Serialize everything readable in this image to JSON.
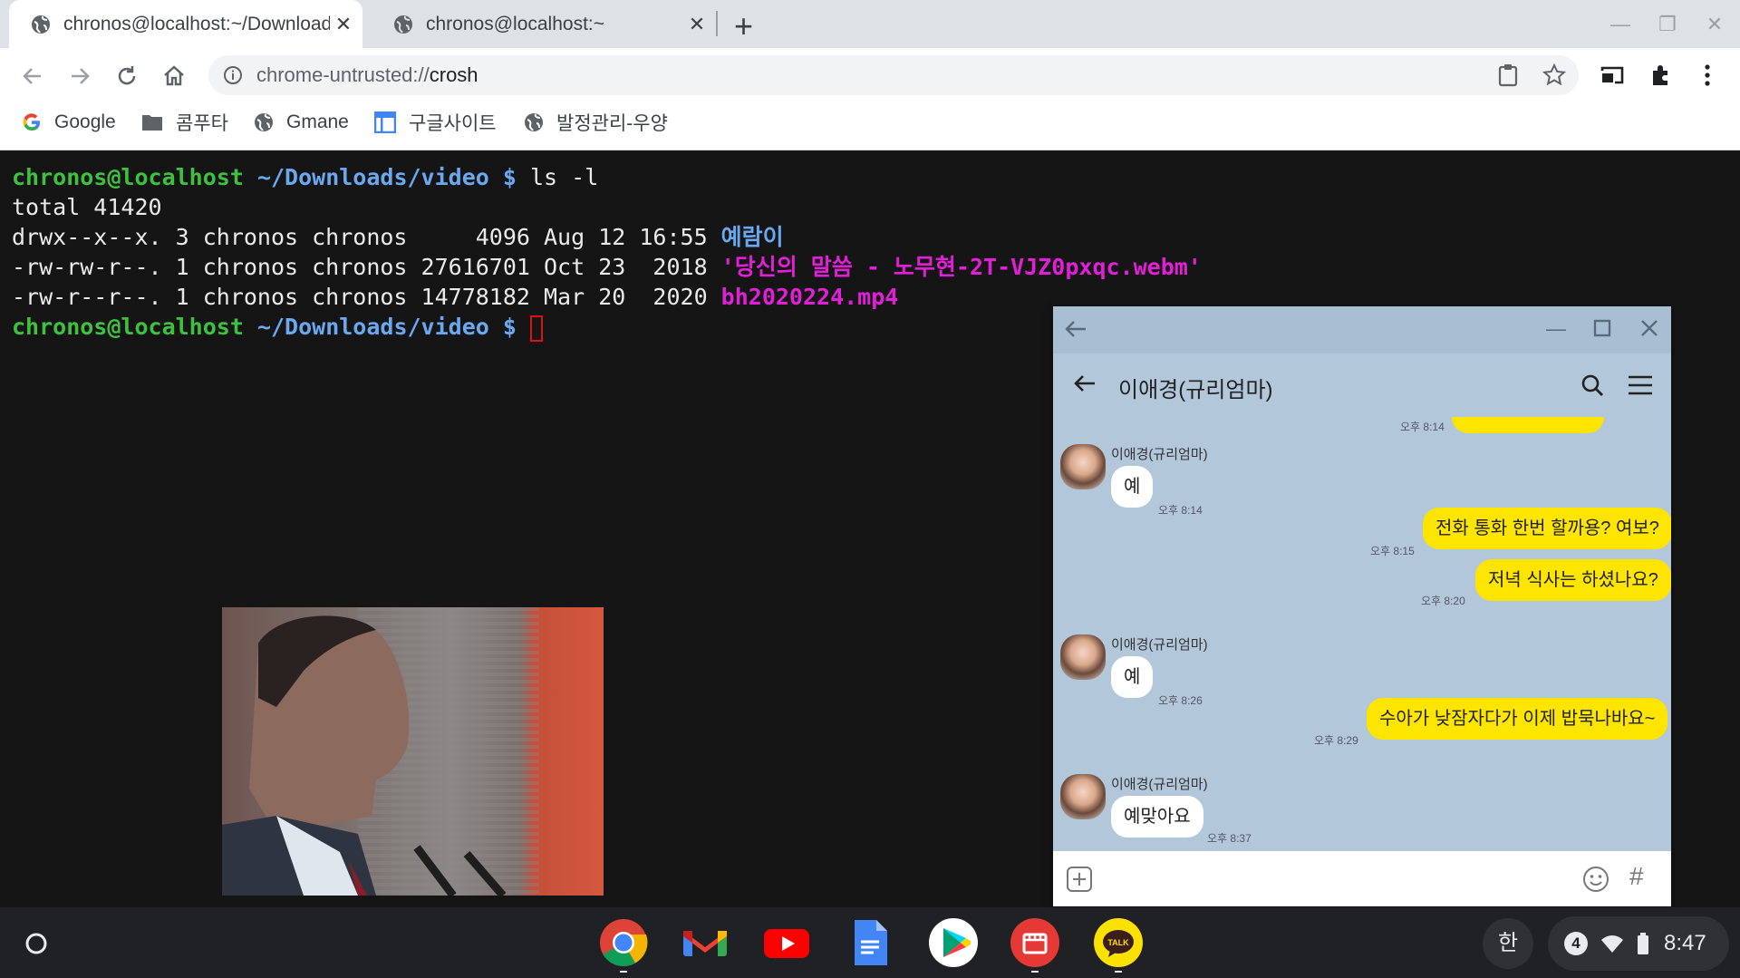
{
  "browser": {
    "tabs": [
      {
        "title": "chronos@localhost:~/Downloads/video",
        "icon": "globe-icon"
      },
      {
        "title": "chronos@localhost:~",
        "icon": "globe-icon"
      }
    ],
    "url_prefix": "chrome-untrusted://",
    "url_host": "crosh",
    "bookmarks": [
      {
        "label": "Google",
        "icon": "google-icon"
      },
      {
        "label": "콤푸타",
        "icon": "folder-icon"
      },
      {
        "label": "Gmane",
        "icon": "globe-icon"
      },
      {
        "label": "구글사이트",
        "icon": "sites-icon"
      },
      {
        "label": "발정관리-우양",
        "icon": "globe-icon"
      }
    ]
  },
  "terminal": {
    "prompt_user": "chronos@localhost",
    "prompt_path": "~/Downloads/video",
    "prompt_symbol": "$",
    "command": "ls -l",
    "total_line": "total 41420",
    "listing": [
      {
        "meta": "drwx--x--x. 3 chronos chronos     4096 Aug 12 16:55 ",
        "name": "예람이",
        "kind": "dir"
      },
      {
        "meta": "-rw-rw-r--. 1 chronos chronos 27616701 Oct 23  2018 ",
        "name": "'당신의 말씀 - 노무현-2T-VJZ0pxqc.webm'",
        "kind": "media"
      },
      {
        "meta": "-rw-r--r--. 1 chronos chronos 14778182 Mar 20  2020 ",
        "name": "bh2020224.mp4",
        "kind": "media"
      }
    ]
  },
  "kakao": {
    "contact": "이애경(규리엄마)",
    "messages": [
      {
        "side": "right",
        "text": "",
        "time": "오후 8:14"
      },
      {
        "side": "left",
        "sender": "이애경(규리엄마)",
        "text": "예",
        "time": "오후 8:14"
      },
      {
        "side": "right",
        "text": "전화 통화 한번 할까용? 여보?",
        "time": "오후 8:15"
      },
      {
        "side": "right",
        "text": "저녁 식사는 하셨나요?",
        "time": "오후 8:20"
      },
      {
        "side": "left",
        "sender": "이애경(규리엄마)",
        "text": "예",
        "time": "오후 8:26"
      },
      {
        "side": "right",
        "text": "수아가 낮잠자다가 이제 밥묵나바요~",
        "time": "오후 8:29"
      },
      {
        "side": "left",
        "sender": "이애경(규리엄마)",
        "text": "예맞아요",
        "time": "오후 8:37"
      }
    ],
    "hash_label": "#"
  },
  "shelf": {
    "apps": [
      "chrome-icon",
      "gmail-icon",
      "youtube-icon",
      "docs-icon",
      "play-store-icon",
      "video-player-icon",
      "kakaotalk-icon"
    ],
    "kakao_badge": "TALK",
    "ime": "한",
    "notification_count": "4",
    "time": "8:47"
  },
  "colors": {
    "prompt_user": "#3dc23d",
    "prompt_path": "#6aa8f0",
    "media_file": "#e11fd6",
    "kakao_bg": "#b2c7d9",
    "kakao_bubble": "#fee500"
  }
}
